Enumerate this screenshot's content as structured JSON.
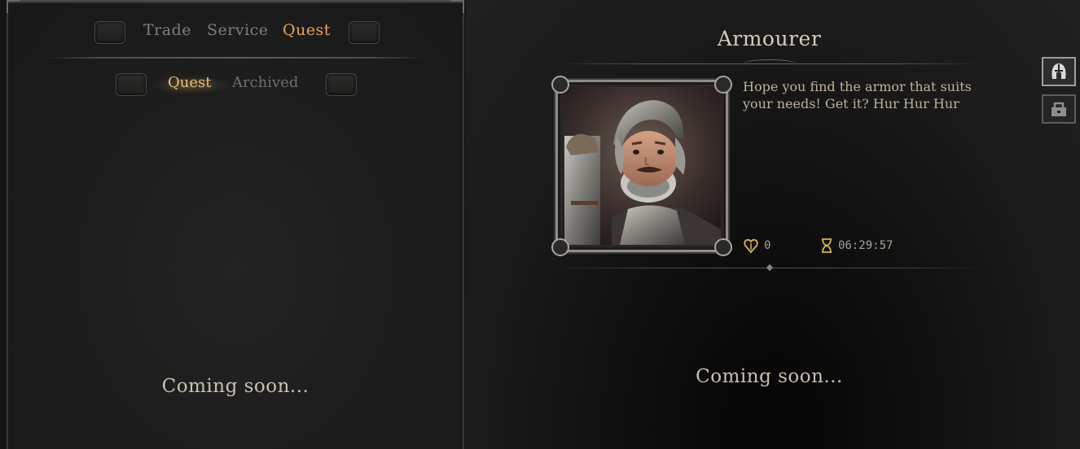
{
  "left": {
    "tabs": [
      {
        "label": "Trade"
      },
      {
        "label": "Service"
      },
      {
        "label": "Quest"
      }
    ],
    "subtabs": [
      {
        "label": "Quest"
      },
      {
        "label": "Archived"
      }
    ],
    "coming_soon": "Coming soon..."
  },
  "npc": {
    "name": "Armourer",
    "dialogue": "Hope you find the armor that suits your needs! Get it? Hur Hur Hur",
    "reputation": "0",
    "timer": "06:29:57",
    "coming_soon": "Coming soon..."
  },
  "colors": {
    "active_tab": "#e8a456",
    "active_subtab": "#e8c07a",
    "inactive_tab": "#7e7e7e",
    "text_body": "#bfb297"
  },
  "icons": {
    "reputation": "heart-shield-icon",
    "timer": "hourglass-icon",
    "side_buttons": [
      "helmet-icon",
      "chest-armor-icon"
    ]
  }
}
